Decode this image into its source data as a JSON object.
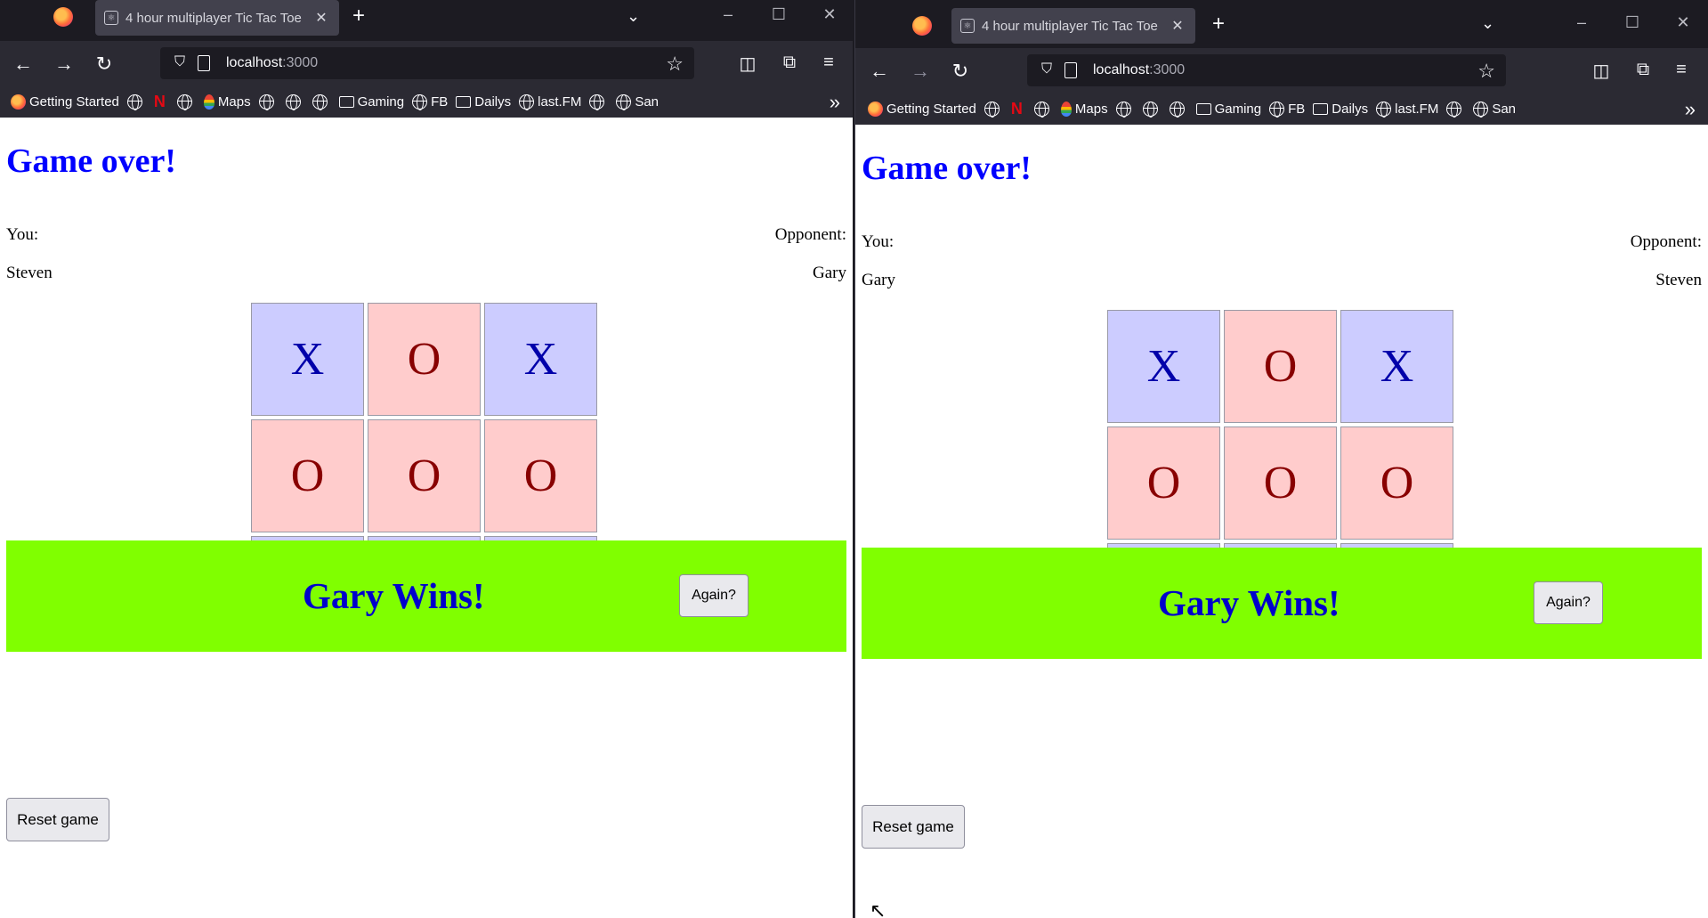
{
  "windows": [
    {
      "tab": {
        "title": "4 hour multiplayer Tic Tac Toe",
        "close": "✕"
      },
      "url": {
        "host": "localhost",
        "port": ":3000"
      },
      "bookmarks": {
        "getting_started": "Getting Started",
        "maps": "Maps",
        "gaming": "Gaming",
        "fb": "FB",
        "dailys": "Dailys",
        "lastfm": "last.FM",
        "san": "San"
      },
      "game": {
        "heading": "Game over!",
        "you_label": "You:",
        "opponent_label": "Opponent:",
        "you_name": "Steven",
        "opponent_name": "Gary",
        "board": [
          "X",
          "O",
          "X",
          "O",
          "O",
          "O"
        ],
        "result": "Gary Wins!",
        "again_label": "Again?",
        "reset_label": "Reset game"
      }
    },
    {
      "tab": {
        "title": "4 hour multiplayer Tic Tac Toe",
        "close": "✕"
      },
      "url": {
        "host": "localhost",
        "port": ":3000"
      },
      "bookmarks": {
        "getting_started": "Getting Started",
        "maps": "Maps",
        "gaming": "Gaming",
        "fb": "FB",
        "dailys": "Dailys",
        "lastfm": "last.FM",
        "san": "San"
      },
      "game": {
        "heading": "Game over!",
        "you_label": "You:",
        "opponent_label": "Opponent:",
        "you_name": "Gary",
        "opponent_name": "Steven",
        "board": [
          "X",
          "O",
          "X",
          "O",
          "O",
          "O"
        ],
        "result": "Gary Wins!",
        "again_label": "Again?",
        "reset_label": "Reset game"
      }
    }
  ],
  "colors": {
    "heading": "#0000ff",
    "win_banner": "#80ff00",
    "x_cell": "#ccccff",
    "o_cell": "#ffcccc"
  }
}
